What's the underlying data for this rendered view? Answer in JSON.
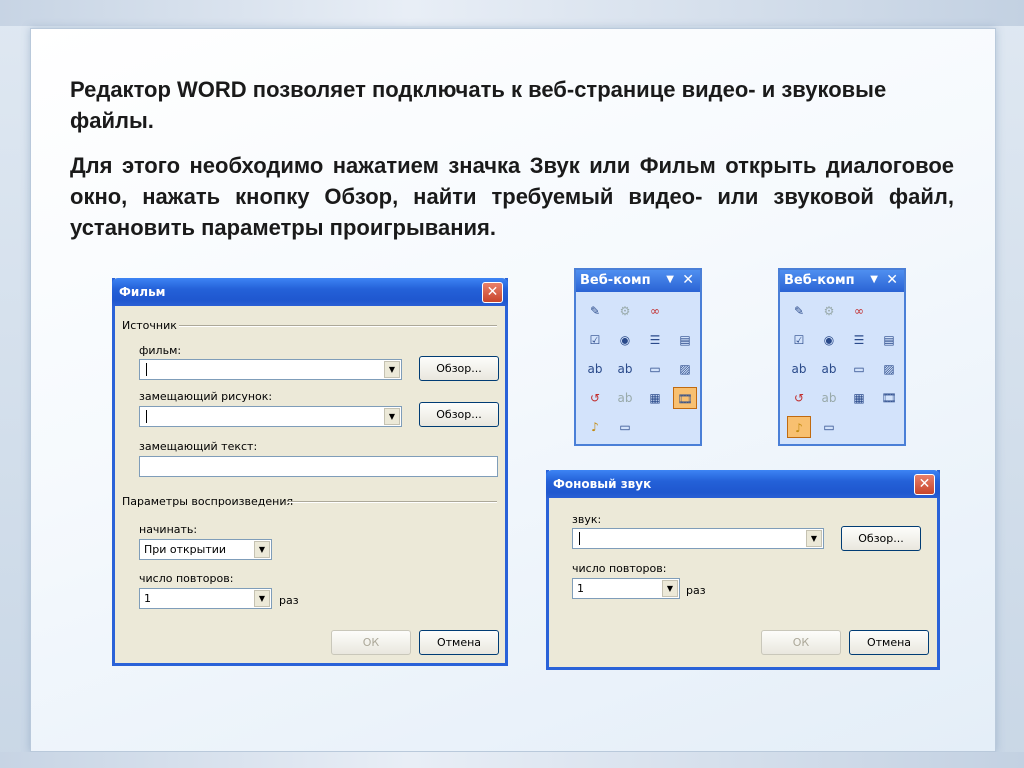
{
  "slide": {
    "paragraph1": "Редактор WORD позволяет подключать к веб-странице видео- и звуковые файлы.",
    "paragraph2": "Для этого необходимо нажатием значка Звук или Фильм открыть диалоговое окно, нажать кнопку Обзор, найти требуемый видео- или звуковой файл, установить параметры проигрывания."
  },
  "film_dialog": {
    "title": "Фильм",
    "close": "✕",
    "source_group": "Источник",
    "film_label": "фильм:",
    "film_value": "",
    "browse1": "Обзор...",
    "picture_label": "замещающий рисунок:",
    "picture_value": "",
    "browse2": "Обзор...",
    "alt_text_label": "замещающий текст:",
    "alt_text_value": "",
    "playback_group": "Параметры воспроизведения",
    "start_label": "начинать:",
    "start_value": "При открытии",
    "loop_label": "число повторов:",
    "loop_value": "1",
    "times_label": "раз",
    "ok": "ОК",
    "cancel": "Отмена"
  },
  "sound_dialog": {
    "title": "Фоновый звук",
    "close": "✕",
    "sound_label": "звук:",
    "sound_value": "",
    "browse": "Обзор...",
    "loop_label": "число повторов:",
    "loop_value": "1",
    "times_label": "раз",
    "ok": "ОК",
    "cancel": "Отмена"
  },
  "toolbar_left": {
    "title": "Веб-комп",
    "selected": "movie"
  },
  "toolbar_right": {
    "title": "Веб-комп",
    "selected": "sound"
  },
  "icons": {
    "design": "✎",
    "properties": "⚙",
    "script": "∞",
    "checkbox": "☑",
    "radio": "◉",
    "dropdown": "☰",
    "listbox": "▤",
    "textbox": "ab",
    "textarea": "ab",
    "submit": "▭",
    "image_submit": "▨",
    "reset": "↺",
    "hidden": "ab",
    "password": "▦",
    "movie": "🎞",
    "sound": "♪",
    "scrolling_text": "▭",
    "dropdown_arrow": "▼",
    "close": "✕"
  },
  "colors": {
    "accent": "#2461d8",
    "dialog_bg": "#ece9d8",
    "toolbar_bg": "#d3e3fb"
  }
}
